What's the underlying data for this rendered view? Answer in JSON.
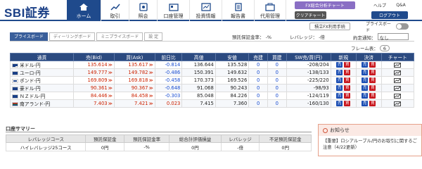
{
  "header": {
    "logo": "SBI証券",
    "nav": [
      {
        "label": "ホーム",
        "icon": "home-icon",
        "active": true
      },
      {
        "label": "取引",
        "icon": "trade-icon"
      },
      {
        "label": "照会",
        "icon": "inquiry-icon"
      },
      {
        "label": "口座管理",
        "icon": "account-icon"
      },
      {
        "label": "投資情報",
        "icon": "info-icon"
      },
      {
        "label": "報告書",
        "icon": "report-icon"
      },
      {
        "label": "代用管理",
        "icon": "collateral-icon"
      }
    ],
    "fx_chart_btn": "FX総合分析チャート",
    "quick_chart_btn": "クリアチャート",
    "help": "ヘルプ",
    "qa": "Q&A",
    "logout": "ログアウト",
    "fx_tools_btn": "積立FX利用手続",
    "private_label": "プライスボード"
  },
  "tabs": [
    "プライスボード",
    "ディーリングボード",
    "ミニプライスボード",
    "設 定"
  ],
  "controls": {
    "margin_rate_label": "預託保証金率：",
    "margin_rate_value": "-%",
    "leverage_label": "レバレッジ：",
    "leverage_value": "-倍",
    "order_label": "約定通知：",
    "order_value": "なし",
    "frame_label": "フレーム表：",
    "frame_value": "6"
  },
  "table": {
    "headers": [
      "通貨",
      "売(Bid)",
      "買(Ask)",
      "前日比",
      "高値",
      "安値",
      "売建",
      "買建",
      "SW売/買(円)",
      "新規",
      "決済",
      "チャート"
    ],
    "rows": [
      {
        "pair": "米ドル-円",
        "flag": "us",
        "bid": "135.614",
        "ask": "135.617",
        "chg": "-0.814",
        "high": "136.644",
        "low": "135.528",
        "sell": "0",
        "buy": "0",
        "sw": "-208/204"
      },
      {
        "pair": "ユーロ-円",
        "flag": "eu",
        "bid": "149.777",
        "ask": "149.782",
        "chg": "-0.486",
        "high": "150.391",
        "low": "149.632",
        "sell": "0",
        "buy": "0",
        "sw": "-138/133"
      },
      {
        "pair": "ポンド-円",
        "flag": "gb",
        "bid": "169.809",
        "ask": "169.818",
        "chg": "-0.458",
        "high": "170.373",
        "low": "169.526",
        "sell": "0",
        "buy": "0",
        "sw": "-225/220"
      },
      {
        "pair": "豪ドル-円",
        "flag": "au",
        "bid": "90.361",
        "ask": "90.367",
        "chg": "-0.648",
        "high": "91.068",
        "low": "90.243",
        "sell": "0",
        "buy": "0",
        "sw": "-98/93"
      },
      {
        "pair": "ＮＺドル-円",
        "flag": "nz",
        "bid": "84.446",
        "ask": "84.458",
        "chg": "-0.303",
        "high": "85.048",
        "low": "84.226",
        "sell": "0",
        "buy": "0",
        "sw": "-124/119"
      },
      {
        "pair": "南アランド-円",
        "flag": "za",
        "bid": "7.403",
        "ask": "7.421",
        "chg": "0.023",
        "high": "7.415",
        "low": "7.360",
        "sell": "0",
        "buy": "0",
        "sw": "-160/130"
      }
    ],
    "buy_label": "買",
    "sell_label": "売"
  },
  "summary": {
    "title": "口座サマリー",
    "headers": [
      "レバレッジコース",
      "預託保証金",
      "預託保証金率",
      "総合計評価損益",
      "レバレッジ",
      "不足預託保証金"
    ],
    "row": [
      "ハイレバレッジ25コース",
      "0円",
      "-%",
      "0円",
      "-倍",
      "0円"
    ]
  },
  "news": {
    "title": "お知らせ",
    "body": "【重要】ロシアルーブル/円のお取引に関するご注意（4/22更新）"
  },
  "colors": {
    "header_blue": "#1f4a8c",
    "sell": "#c8161d",
    "buy": "#1b4eb3",
    "fx_btn": "#8a6fc4"
  }
}
